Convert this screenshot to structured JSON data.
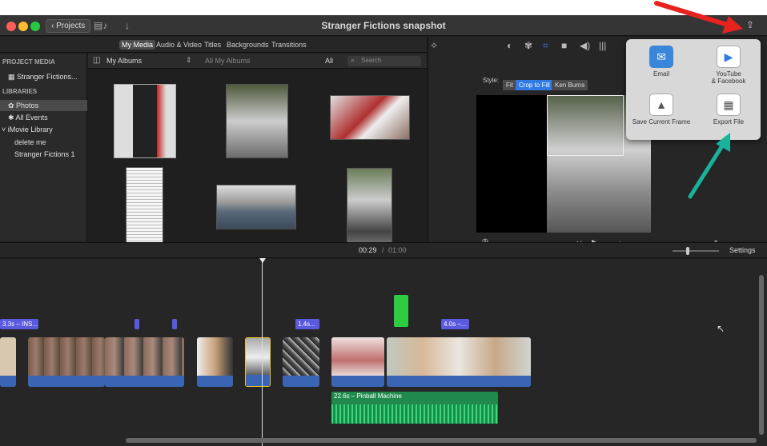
{
  "window": {
    "title": "Stranger Fictions snapshot",
    "back_button": "Projects"
  },
  "media_tabs": [
    "My Media",
    "Audio & Video",
    "Titles",
    "Backgrounds",
    "Transitions"
  ],
  "sidebar": {
    "project_header": "PROJECT MEDIA",
    "project_item": "Stranger Fictions...",
    "libraries_header": "LIBRARIES",
    "items": [
      "Photos",
      "All Events",
      "iMovie Library",
      "delete me",
      "Stranger Fictions 1"
    ]
  },
  "browser": {
    "album_select": "My Albums",
    "breadcrumb": "All My Albums",
    "filter": "All",
    "search_placeholder": "Search"
  },
  "viewer": {
    "style_label": "Style:",
    "style_options": [
      "Fit",
      "Crop to Fill",
      "Ken Burns"
    ],
    "selected_style": "Crop to Fill"
  },
  "share_popover": {
    "items": [
      "Email",
      "YouTube\n& Facebook",
      "Save Current Frame",
      "Export File"
    ]
  },
  "timecode": {
    "current": "00:29",
    "separator": "/",
    "total": "01:00"
  },
  "settings_label": "Settings",
  "timeline": {
    "title_clips": [
      "3.3s – INS...",
      "1.4s...",
      "4.0s –..."
    ],
    "audio_clip": "22.6s – Pinball Machine"
  },
  "colors": {
    "accent": "#2f7ae5",
    "annotation_red": "#e8231f",
    "annotation_teal": "#19b29a",
    "title_clip": "#5a5ae0",
    "audio_clip": "#1f8a4c"
  }
}
